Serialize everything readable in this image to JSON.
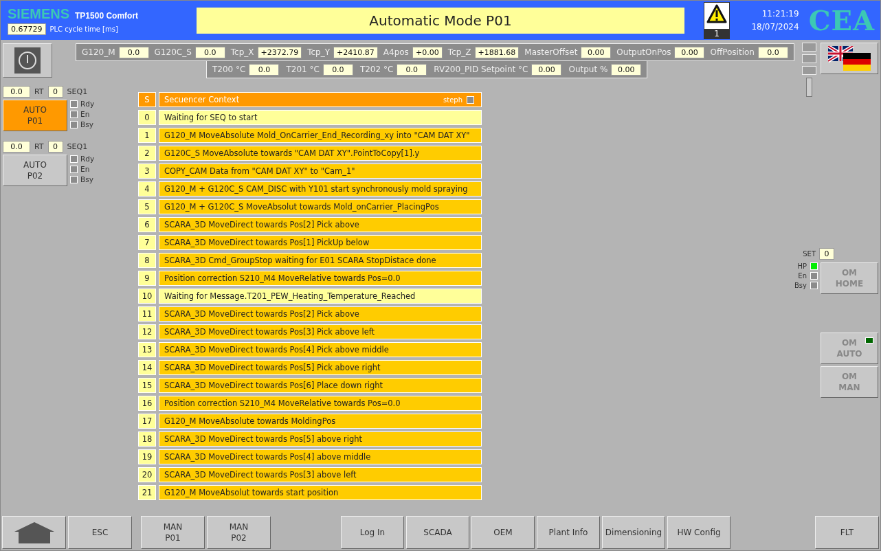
{
  "header": {
    "brand": "SIEMENS",
    "model": "TP1500 Comfort",
    "cycle_value": "0.67729",
    "cycle_label": "PLC cycle time [ms]",
    "title": "Automatic Mode P01",
    "alarm_count": "1",
    "time": "11:21:19",
    "date": "18/07/2024",
    "logo": "CEA"
  },
  "params_row1": [
    {
      "label": "G120_M",
      "value": "0.0"
    },
    {
      "label": "G120C_S",
      "value": "0.0"
    },
    {
      "label": "Tcp_X",
      "value": "+2372.79"
    },
    {
      "label": "Tcp_Y",
      "value": "+2410.87"
    },
    {
      "label": "A4pos",
      "value": "+0.00"
    },
    {
      "label": "Tcp_Z",
      "value": "+1881.68"
    },
    {
      "label": "MasterOffset",
      "value": "0.00"
    },
    {
      "label": "OutputOnPos",
      "value": "0.00"
    },
    {
      "label": "OffPosition",
      "value": "0.0"
    }
  ],
  "params_row2": [
    {
      "label": "T200 °C",
      "value": "0.0"
    },
    {
      "label": "T201 °C",
      "value": "0.0"
    },
    {
      "label": "T202 °C",
      "value": "0.0"
    },
    {
      "label": "RV200_PID Setpoint °C",
      "value": "0.00"
    },
    {
      "label": "Output %",
      "value": "0.00"
    }
  ],
  "programs": [
    {
      "time": "0.0",
      "rt_label": "RT",
      "seq_value": "0",
      "seq_label": "SEQ1",
      "button": "AUTO\nP01",
      "selected": true,
      "indicators": [
        {
          "label": "Rdy",
          "on": false
        },
        {
          "label": "En",
          "on": false
        },
        {
          "label": "Bsy",
          "on": false
        }
      ]
    },
    {
      "time": "0.0",
      "rt_label": "RT",
      "seq_value": "0",
      "seq_label": "SEQ1",
      "button": "AUTO\nP02",
      "selected": false,
      "indicators": [
        {
          "label": "Rdy",
          "on": false
        },
        {
          "label": "En",
          "on": false
        },
        {
          "label": "Bsy",
          "on": false
        }
      ]
    }
  ],
  "sequence": {
    "step_header": "S",
    "context_header": "Secuencer Context",
    "user_label": "steph",
    "user_checked": false,
    "steps": [
      {
        "step": "0",
        "text": "Waiting for SEQ to start",
        "kind": "wait"
      },
      {
        "step": "1",
        "text": "G120_M MoveAbsolute Mold_OnCarrier_End_Recording_xy into \"CAM DAT XY\"",
        "kind": "action"
      },
      {
        "step": "2",
        "text": "G120C_S MoveAbsolute towards \"CAM DAT XY\".PointToCopy[1].y",
        "kind": "action"
      },
      {
        "step": "3",
        "text": "COPY_CAM Data from \"CAM DAT XY\" to \"Cam_1\"",
        "kind": "action"
      },
      {
        "step": "4",
        "text": "G120_M + G120C_S CAM_DISC with Y101 start synchronously mold spraying",
        "kind": "action"
      },
      {
        "step": "5",
        "text": "G120_M + G120C_S MoveAbsolut towards Mold_onCarrier_PlacingPos",
        "kind": "action"
      },
      {
        "step": "6",
        "text": "SCARA_3D MoveDirect towards Pos[2] Pick above",
        "kind": "action"
      },
      {
        "step": "7",
        "text": "SCARA_3D MoveDirect towards Pos[1] PickUp below",
        "kind": "action"
      },
      {
        "step": "8",
        "text": "SCARA_3D Cmd_GroupStop waiting for E01 SCARA StopDistace done",
        "kind": "action"
      },
      {
        "step": "9",
        "text": "Position correction S210_M4 MoveRelative towards Pos=0.0",
        "kind": "action"
      },
      {
        "step": "10",
        "text": "Waiting for Message.T201_PEW_Heating_Temperature_Reached",
        "kind": "wait"
      },
      {
        "step": "11",
        "text": "SCARA_3D MoveDirect towards Pos[2] Pick above",
        "kind": "action"
      },
      {
        "step": "12",
        "text": "SCARA_3D MoveDirect towards Pos[3] Pick above left",
        "kind": "action"
      },
      {
        "step": "13",
        "text": "SCARA_3D MoveDirect towards Pos[4] Pick above middle",
        "kind": "action"
      },
      {
        "step": "14",
        "text": "SCARA_3D MoveDirect towards Pos[5] Pick above right",
        "kind": "action"
      },
      {
        "step": "15",
        "text": "SCARA_3D MoveDirect towards Pos[6] Place down right",
        "kind": "action"
      },
      {
        "step": "16",
        "text": "Position correction S210_M4 MoveRelative towards Pos=0.0",
        "kind": "action"
      },
      {
        "step": "17",
        "text": "G120_M MoveAbsolute towards MoldingPos",
        "kind": "action"
      },
      {
        "step": "18",
        "text": "SCARA_3D MoveDirect towards Pos[5] above right",
        "kind": "action"
      },
      {
        "step": "19",
        "text": "SCARA_3D MoveDirect towards Pos[4] above middle",
        "kind": "action"
      },
      {
        "step": "20",
        "text": "SCARA_3D MoveDirect towards Pos[3] above left",
        "kind": "action"
      },
      {
        "step": "21",
        "text": "G120_M MoveAbsolut towards start position",
        "kind": "action"
      }
    ]
  },
  "operating_mode": {
    "set_label": "SET",
    "set_value": "0",
    "indicators": [
      {
        "label": "HP",
        "on": true
      },
      {
        "label": "En",
        "on": false
      },
      {
        "label": "Bsy",
        "on": false
      }
    ],
    "buttons": [
      {
        "label": "OM\nHOME",
        "active": false
      },
      {
        "label": "OM\nAUTO",
        "active": true
      },
      {
        "label": "OM\nMAN",
        "active": false
      }
    ]
  },
  "bottom_groups": [
    [
      {
        "kind": "home"
      },
      {
        "kind": "text",
        "label": "ESC"
      }
    ],
    [
      {
        "kind": "text",
        "label": "MAN\nP01"
      },
      {
        "kind": "text",
        "label": "MAN\nP02"
      }
    ],
    [
      {
        "kind": "text",
        "label": "Log In"
      },
      {
        "kind": "text",
        "label": "SCADA"
      },
      {
        "kind": "text",
        "label": "OEM"
      },
      {
        "kind": "text",
        "label": "Plant Info"
      },
      {
        "kind": "text",
        "label": "Dimensioning"
      },
      {
        "kind": "text",
        "label": "HW Config"
      }
    ],
    [
      {
        "kind": "text",
        "label": "FLT"
      }
    ]
  ]
}
